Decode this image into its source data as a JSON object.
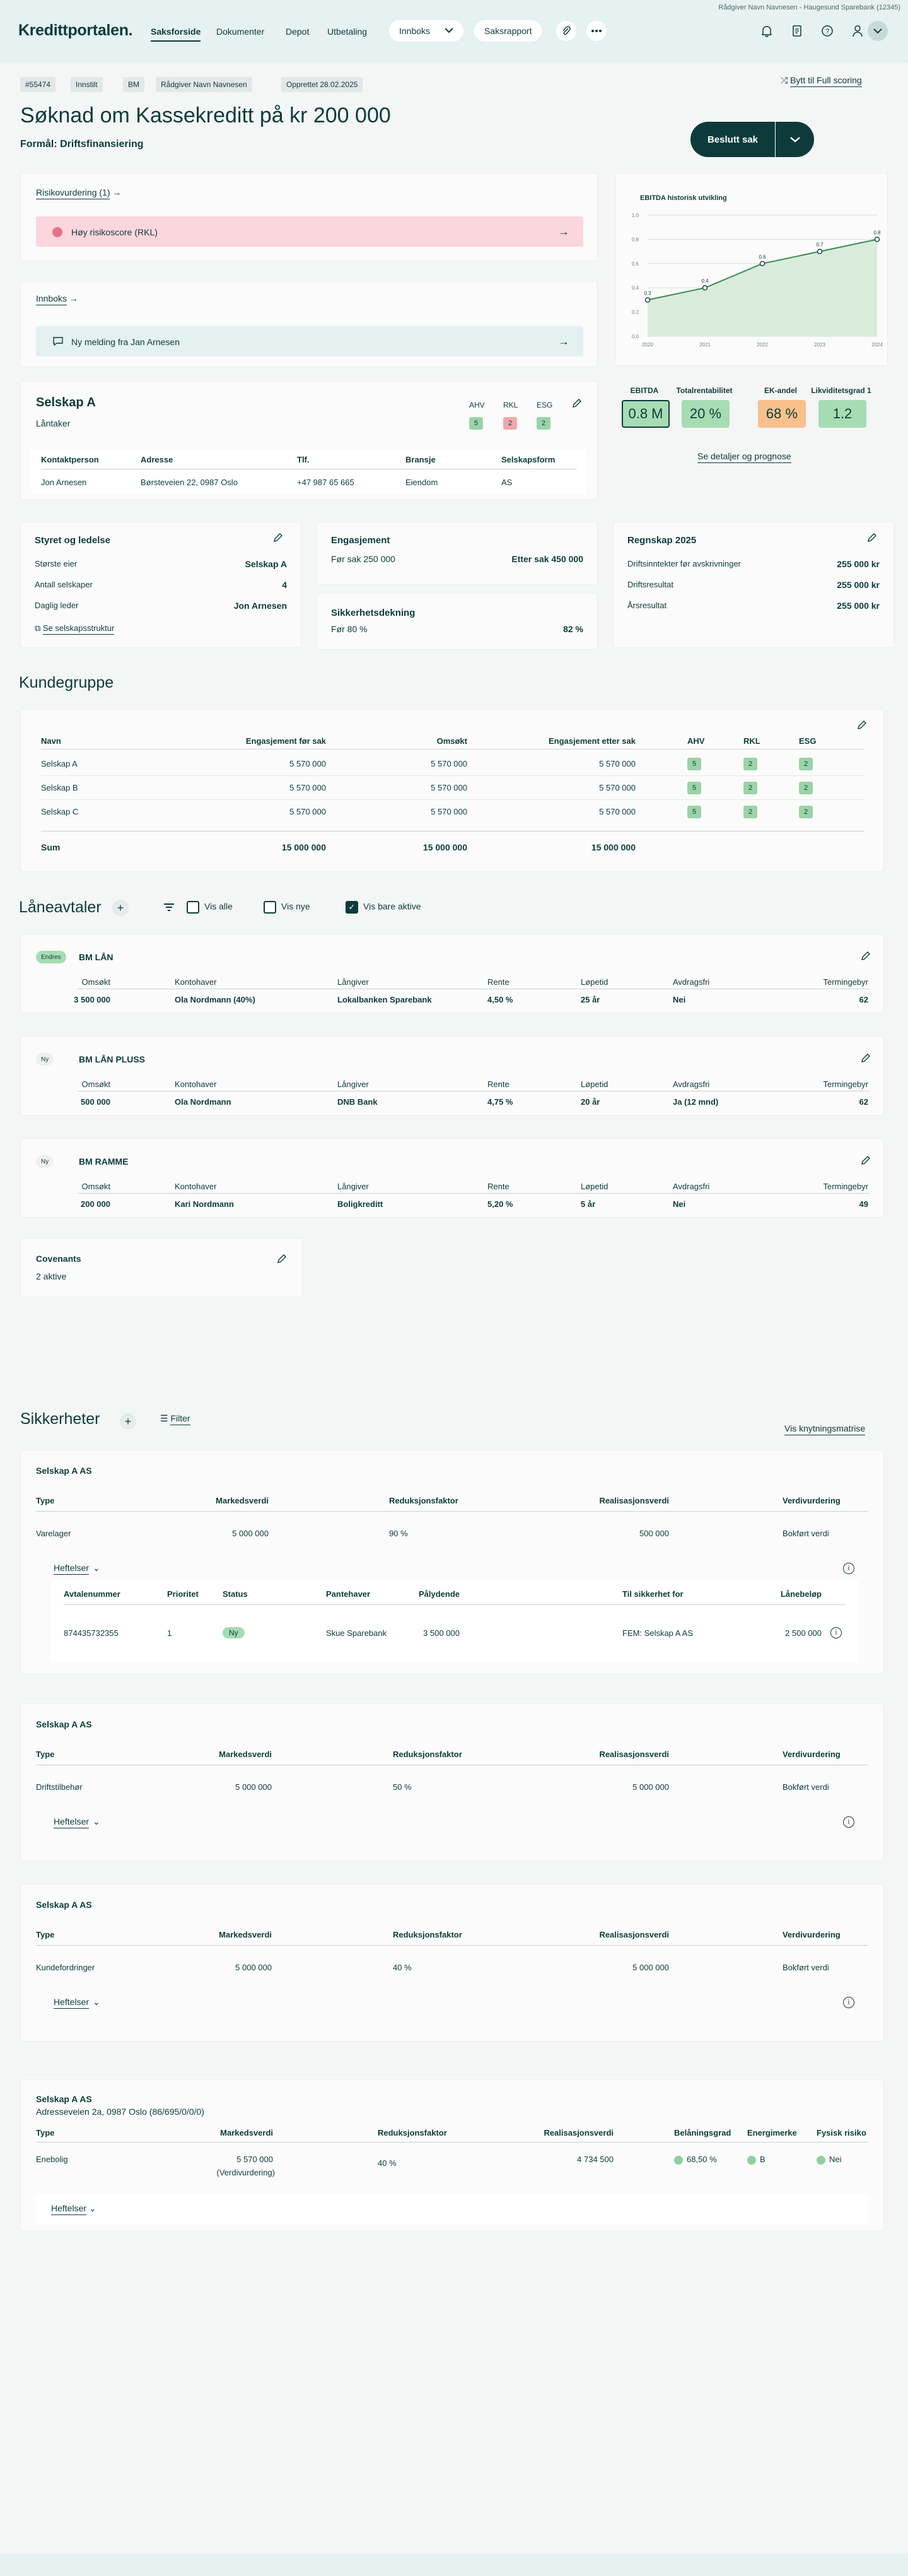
{
  "header": {
    "logo": "Kredittportalen.",
    "user_info": "Rådgiver Navn Navnesen - Haugesund Sparebank (12345)",
    "nav": [
      "Saksforside",
      "Dokumenter",
      "Depot",
      "Utbetaling"
    ],
    "inbox_label": "Innboks",
    "report_label": "Saksrapport"
  },
  "case": {
    "tags": [
      "#55474",
      "Innstilt",
      "BM",
      "Rådgiver Navn Navnesen",
      "Opprettet 28.02.2025"
    ],
    "full_scoring": "Bytt til Full scoring",
    "title": "Søknad om Kassekreditt på kr 200 000",
    "purpose": "Formål: Driftsfinansiering",
    "decide_label": "Beslutt sak"
  },
  "risk": {
    "title": "Risikovurdering (1)",
    "alert": "Høy risikoscore (RKL)"
  },
  "inbox": {
    "title": "Innboks",
    "message": "Ny melding fra Jan Arnesen"
  },
  "chart": {
    "title": "EBITDA historisk utvikling",
    "yticks": [
      "1.0",
      "0.8",
      "0.6",
      "0.4",
      "0.2",
      "0.0"
    ]
  },
  "chart_data": {
    "type": "area",
    "title": "EBITDA historisk utvikling",
    "x": [
      "2020",
      "2021",
      "2022",
      "2023",
      "2024"
    ],
    "values": [
      0.3,
      0.4,
      0.6,
      0.7,
      0.8
    ],
    "data_labels": [
      "0.3",
      "0.4",
      "0.6",
      "0.7",
      "0.8"
    ],
    "ylim": [
      0,
      1.0
    ],
    "grid": true,
    "color": "#3c8a4e"
  },
  "kpis": [
    {
      "label": "EBITDA",
      "value": "0.8 M",
      "color": "#a6dcb2"
    },
    {
      "label": "Totalrentabilitet",
      "value": "20 %",
      "color": "#a6dcb2"
    },
    {
      "label": "EK-andel",
      "value": "68 %",
      "color": "#f7c08c"
    },
    {
      "label": "Likviditetsgrad 1",
      "value": "1.2",
      "color": "#a6dcb2"
    }
  ],
  "kpi_link": "Se detaljer og prognose",
  "company": {
    "name": "Selskap A",
    "role": "Låntaker",
    "badges": [
      {
        "label": "AHV",
        "value": "5"
      },
      {
        "label": "RKL",
        "value": "2"
      },
      {
        "label": "ESG",
        "value": "2"
      }
    ],
    "headers": [
      "Kontaktperson",
      "Adresse",
      "Tlf.",
      "Bransje",
      "Selskapsform"
    ],
    "values": [
      "Jon Arnesen",
      "Børsteveien 22, 0987 Oslo",
      "+47 987 65 665",
      "Eiendom",
      "AS"
    ]
  },
  "board": {
    "title": "Styret og ledelse",
    "rows": [
      {
        "k": "Største eier",
        "v": "Selskap A"
      },
      {
        "k": "Antall selskaper",
        "v": "4"
      },
      {
        "k": "Daglig leder",
        "v": "Jon Arnesen"
      }
    ],
    "link": "Se selskapsstruktur"
  },
  "engagement": {
    "title": "Engasjement",
    "before": "Før sak 250 000",
    "after": "Etter sak 450 000"
  },
  "coverage": {
    "title": "Sikkerhetsdekning",
    "before": "Før 80 %",
    "after": "82 %"
  },
  "accounts": {
    "title": "Regnskap 2025",
    "rows": [
      {
        "k": "Driftsinntekter før avskrivninger",
        "v": "255 000 kr"
      },
      {
        "k": "Driftsresultat",
        "v": "255 000 kr"
      },
      {
        "k": "Årsresultat",
        "v": "255 000 kr"
      }
    ]
  },
  "customer_group": {
    "title": "Kundegruppe",
    "headers": [
      "Navn",
      "Engasjement før sak",
      "Omsøkt",
      "Engasjement etter sak",
      "AHV",
      "RKL",
      "ESG"
    ],
    "rows": [
      [
        "Selskap A",
        "5 570 000",
        "5 570 000",
        "5 570 000",
        "5",
        "2",
        "2"
      ],
      [
        "Selskap B",
        "5 570 000",
        "5 570 000",
        "5 570 000",
        "5",
        "2",
        "2"
      ],
      [
        "Selskap C",
        "5 570 000",
        "5 570 000",
        "5 570 000",
        "5",
        "2",
        "2"
      ]
    ],
    "sum": [
      "Sum",
      "15 000 000",
      "15 000 000",
      "15 000 000"
    ]
  },
  "loans": {
    "title": "Låneavtaler",
    "filters": [
      "Vis alle",
      "Vis nye",
      "Vis bare aktive"
    ],
    "headers": [
      "Omsøkt",
      "Kontohaver",
      "Långiver",
      "Rente",
      "Løpetid",
      "Avdragsfri",
      "Termingebyr"
    ],
    "items": [
      {
        "status": "Endres",
        "name": "BM LÅN",
        "values": [
          "3 500 000",
          "Ola Nordmann (40%)",
          "Lokalbanken Sparebank",
          "4,50 %",
          "25 år",
          "Nei",
          "62"
        ]
      },
      {
        "status": "Ny",
        "name": "BM LÅN PLUSS",
        "values": [
          "500 000",
          "Ola Nordmann",
          "DNB Bank",
          "4,75 %",
          "20 år",
          "Ja (12 mnd)",
          "62"
        ]
      },
      {
        "status": "Ny",
        "name": "BM RAMME",
        "values": [
          "200 000",
          "Kari Nordmann",
          "Boligkreditt",
          "5,20 %",
          "5 år",
          "Nei",
          "49"
        ]
      }
    ]
  },
  "covenants": {
    "title": "Covenants",
    "count": "2 aktive"
  },
  "securities": {
    "title": "Sikkerheter",
    "filter": "Filter",
    "matrix": "Vis knytningsmatrise",
    "details": "Heftelser",
    "headers": [
      "Type",
      "Markedsverdi",
      "Reduksjonsfaktor",
      "Realisasjonsverdi",
      "Verdivurdering"
    ],
    "items": [
      {
        "owner": "Selskap A AS",
        "values": [
          "Varelager",
          "5 000 000",
          "90 %",
          "500 000",
          "Bokført verdi"
        ]
      },
      {
        "owner": "Selskap A AS",
        "values": [
          "Driftstilbehør",
          "5 000 000",
          "50 %",
          "5 000 000",
          "Bokført verdi"
        ]
      },
      {
        "owner": "Selskap A AS",
        "values": [
          "Kundefordringer",
          "5 000 000",
          "40 %",
          "5 000 000",
          "Bokført verdi"
        ]
      }
    ],
    "lien_headers": [
      "Avtalenummer",
      "Prioritet",
      "Status",
      "Pantehaver",
      "Pålydende",
      "Til sikkerhet for",
      "Lånebeløp"
    ],
    "lien_row": [
      "874435732355",
      "1",
      "Ny",
      "Skue Sparebank",
      "3 500 000",
      "FEM: Selskap A AS",
      "2 500 000"
    ],
    "property": {
      "owner": "Selskap A AS",
      "address": "Adresseveien 2a, 0987 Oslo (86/695/0/0/0)",
      "headers": [
        "Type",
        "Markedsverdi",
        "Reduksjonsfaktor",
        "Realisasjonsverdi",
        "Belåningsgrad",
        "Energimerke",
        "Fysisk risiko"
      ],
      "values": [
        "Enebolig",
        "5 570 000",
        "(Verdivurdering)",
        "40 %",
        "4 734 500",
        "68,50 %",
        "B",
        "Nei"
      ]
    }
  }
}
